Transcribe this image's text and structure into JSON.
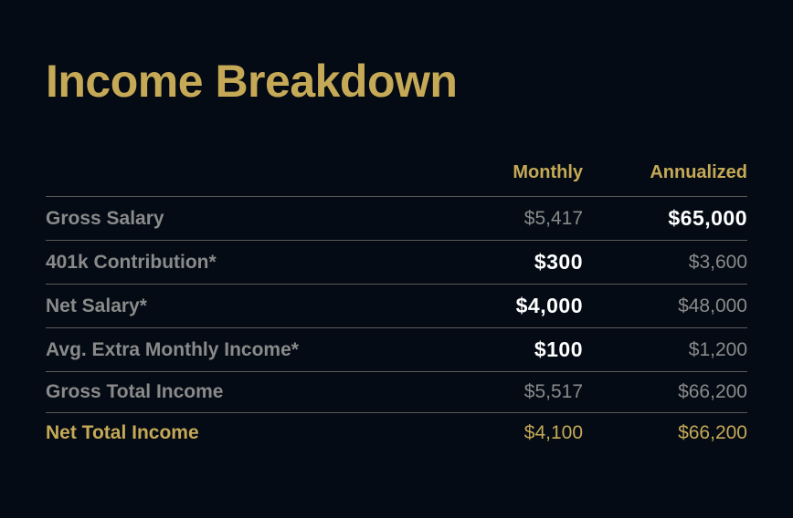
{
  "title": "Income Breakdown",
  "headers": {
    "monthly": "Monthly",
    "annualized": "Annualized"
  },
  "rows": [
    {
      "label": "Gross Salary",
      "monthly": "$5,417",
      "annualized": "$65,000",
      "emphasis": "annualized"
    },
    {
      "label": "401k Contribution*",
      "monthly": "$300",
      "annualized": "$3,600",
      "emphasis": "monthly"
    },
    {
      "label": "Net Salary*",
      "monthly": "$4,000",
      "annualized": "$48,000",
      "emphasis": "monthly"
    },
    {
      "label": "Avg. Extra Monthly Income*",
      "monthly": "$100",
      "annualized": "$1,200",
      "emphasis": "monthly"
    },
    {
      "label": "Gross Total Income",
      "monthly": "$5,517",
      "annualized": "$66,200",
      "emphasis": null
    },
    {
      "label": "Net Total Income",
      "monthly": "$4,100",
      "annualized": "$66,200",
      "emphasis": null,
      "highlight": true
    }
  ]
}
